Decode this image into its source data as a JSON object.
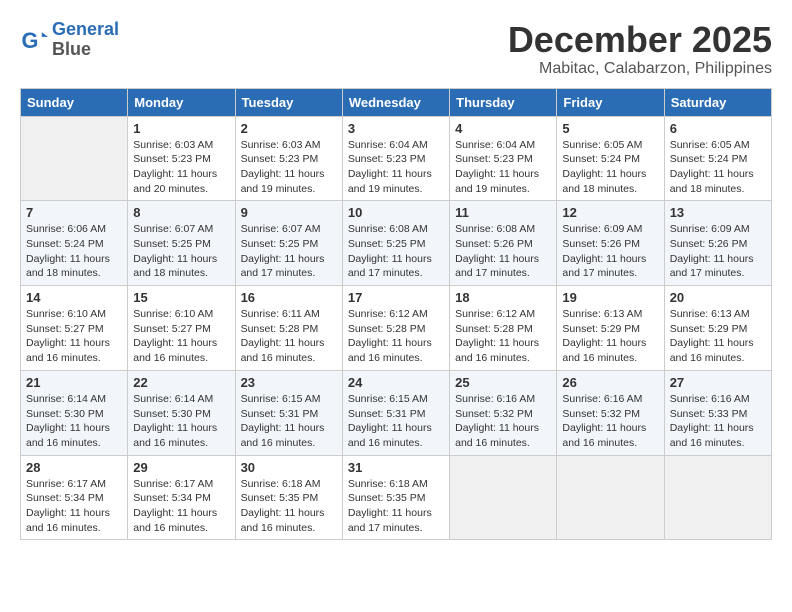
{
  "logo": {
    "line1": "General",
    "line2": "Blue"
  },
  "title": "December 2025",
  "subtitle": "Mabitac, Calabarzon, Philippines",
  "days_of_week": [
    "Sunday",
    "Monday",
    "Tuesday",
    "Wednesday",
    "Thursday",
    "Friday",
    "Saturday"
  ],
  "weeks": [
    [
      {
        "num": "",
        "info": ""
      },
      {
        "num": "1",
        "info": "Sunrise: 6:03 AM\nSunset: 5:23 PM\nDaylight: 11 hours\nand 20 minutes."
      },
      {
        "num": "2",
        "info": "Sunrise: 6:03 AM\nSunset: 5:23 PM\nDaylight: 11 hours\nand 19 minutes."
      },
      {
        "num": "3",
        "info": "Sunrise: 6:04 AM\nSunset: 5:23 PM\nDaylight: 11 hours\nand 19 minutes."
      },
      {
        "num": "4",
        "info": "Sunrise: 6:04 AM\nSunset: 5:23 PM\nDaylight: 11 hours\nand 19 minutes."
      },
      {
        "num": "5",
        "info": "Sunrise: 6:05 AM\nSunset: 5:24 PM\nDaylight: 11 hours\nand 18 minutes."
      },
      {
        "num": "6",
        "info": "Sunrise: 6:05 AM\nSunset: 5:24 PM\nDaylight: 11 hours\nand 18 minutes."
      }
    ],
    [
      {
        "num": "7",
        "info": "Sunrise: 6:06 AM\nSunset: 5:24 PM\nDaylight: 11 hours\nand 18 minutes."
      },
      {
        "num": "8",
        "info": "Sunrise: 6:07 AM\nSunset: 5:25 PM\nDaylight: 11 hours\nand 18 minutes."
      },
      {
        "num": "9",
        "info": "Sunrise: 6:07 AM\nSunset: 5:25 PM\nDaylight: 11 hours\nand 17 minutes."
      },
      {
        "num": "10",
        "info": "Sunrise: 6:08 AM\nSunset: 5:25 PM\nDaylight: 11 hours\nand 17 minutes."
      },
      {
        "num": "11",
        "info": "Sunrise: 6:08 AM\nSunset: 5:26 PM\nDaylight: 11 hours\nand 17 minutes."
      },
      {
        "num": "12",
        "info": "Sunrise: 6:09 AM\nSunset: 5:26 PM\nDaylight: 11 hours\nand 17 minutes."
      },
      {
        "num": "13",
        "info": "Sunrise: 6:09 AM\nSunset: 5:26 PM\nDaylight: 11 hours\nand 17 minutes."
      }
    ],
    [
      {
        "num": "14",
        "info": "Sunrise: 6:10 AM\nSunset: 5:27 PM\nDaylight: 11 hours\nand 16 minutes."
      },
      {
        "num": "15",
        "info": "Sunrise: 6:10 AM\nSunset: 5:27 PM\nDaylight: 11 hours\nand 16 minutes."
      },
      {
        "num": "16",
        "info": "Sunrise: 6:11 AM\nSunset: 5:28 PM\nDaylight: 11 hours\nand 16 minutes."
      },
      {
        "num": "17",
        "info": "Sunrise: 6:12 AM\nSunset: 5:28 PM\nDaylight: 11 hours\nand 16 minutes."
      },
      {
        "num": "18",
        "info": "Sunrise: 6:12 AM\nSunset: 5:28 PM\nDaylight: 11 hours\nand 16 minutes."
      },
      {
        "num": "19",
        "info": "Sunrise: 6:13 AM\nSunset: 5:29 PM\nDaylight: 11 hours\nand 16 minutes."
      },
      {
        "num": "20",
        "info": "Sunrise: 6:13 AM\nSunset: 5:29 PM\nDaylight: 11 hours\nand 16 minutes."
      }
    ],
    [
      {
        "num": "21",
        "info": "Sunrise: 6:14 AM\nSunset: 5:30 PM\nDaylight: 11 hours\nand 16 minutes."
      },
      {
        "num": "22",
        "info": "Sunrise: 6:14 AM\nSunset: 5:30 PM\nDaylight: 11 hours\nand 16 minutes."
      },
      {
        "num": "23",
        "info": "Sunrise: 6:15 AM\nSunset: 5:31 PM\nDaylight: 11 hours\nand 16 minutes."
      },
      {
        "num": "24",
        "info": "Sunrise: 6:15 AM\nSunset: 5:31 PM\nDaylight: 11 hours\nand 16 minutes."
      },
      {
        "num": "25",
        "info": "Sunrise: 6:16 AM\nSunset: 5:32 PM\nDaylight: 11 hours\nand 16 minutes."
      },
      {
        "num": "26",
        "info": "Sunrise: 6:16 AM\nSunset: 5:32 PM\nDaylight: 11 hours\nand 16 minutes."
      },
      {
        "num": "27",
        "info": "Sunrise: 6:16 AM\nSunset: 5:33 PM\nDaylight: 11 hours\nand 16 minutes."
      }
    ],
    [
      {
        "num": "28",
        "info": "Sunrise: 6:17 AM\nSunset: 5:34 PM\nDaylight: 11 hours\nand 16 minutes."
      },
      {
        "num": "29",
        "info": "Sunrise: 6:17 AM\nSunset: 5:34 PM\nDaylight: 11 hours\nand 16 minutes."
      },
      {
        "num": "30",
        "info": "Sunrise: 6:18 AM\nSunset: 5:35 PM\nDaylight: 11 hours\nand 16 minutes."
      },
      {
        "num": "31",
        "info": "Sunrise: 6:18 AM\nSunset: 5:35 PM\nDaylight: 11 hours\nand 17 minutes."
      },
      {
        "num": "",
        "info": ""
      },
      {
        "num": "",
        "info": ""
      },
      {
        "num": "",
        "info": ""
      }
    ]
  ]
}
